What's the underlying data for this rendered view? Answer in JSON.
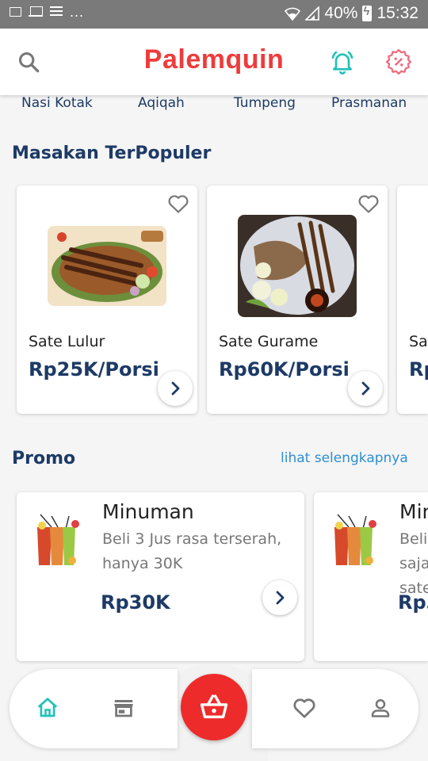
{
  "status_bar": {
    "battery": "40%",
    "time": "15:32",
    "dots": "...",
    "icons": [
      "image-icon",
      "laptop-icon",
      "list-icon",
      "wifi-icon",
      "signal-icon",
      "battery-charging-icon"
    ]
  },
  "header": {
    "title": "Palemquin",
    "left_icon": "search-icon",
    "right_icons": [
      "bell-icon",
      "discount-badge-icon"
    ],
    "brand_color": "#ef3b3b",
    "accent_color": "#22c1b8"
  },
  "categories": [
    "Nasi Kotak",
    "Aqiqah",
    "Tumpeng",
    "Prasmanan"
  ],
  "popular": {
    "title": "Masakan TerPopuler",
    "items": [
      {
        "name": "Sate Lulur",
        "price": "Rp25K/Porsi"
      },
      {
        "name": "Sate Gurame",
        "price": "Rp60K/Porsi"
      },
      {
        "name": "Sa",
        "price": "Rp"
      }
    ]
  },
  "promo": {
    "title": "Promo",
    "see_all": "lihat selengkapnya",
    "items": [
      {
        "title": "Minuman",
        "desc": "Beli 3 Jus rasa terserah, hanya 30K",
        "price": "Rp30K"
      },
      {
        "title": "Min",
        "desc": "Beli saja sate",
        "price": "Rp3"
      }
    ]
  },
  "bottom_nav": {
    "items": [
      "home-icon",
      "store-icon",
      "basket-icon",
      "heart-icon",
      "profile-icon"
    ],
    "active": "home-icon",
    "fab_color": "#ee2b2b"
  }
}
